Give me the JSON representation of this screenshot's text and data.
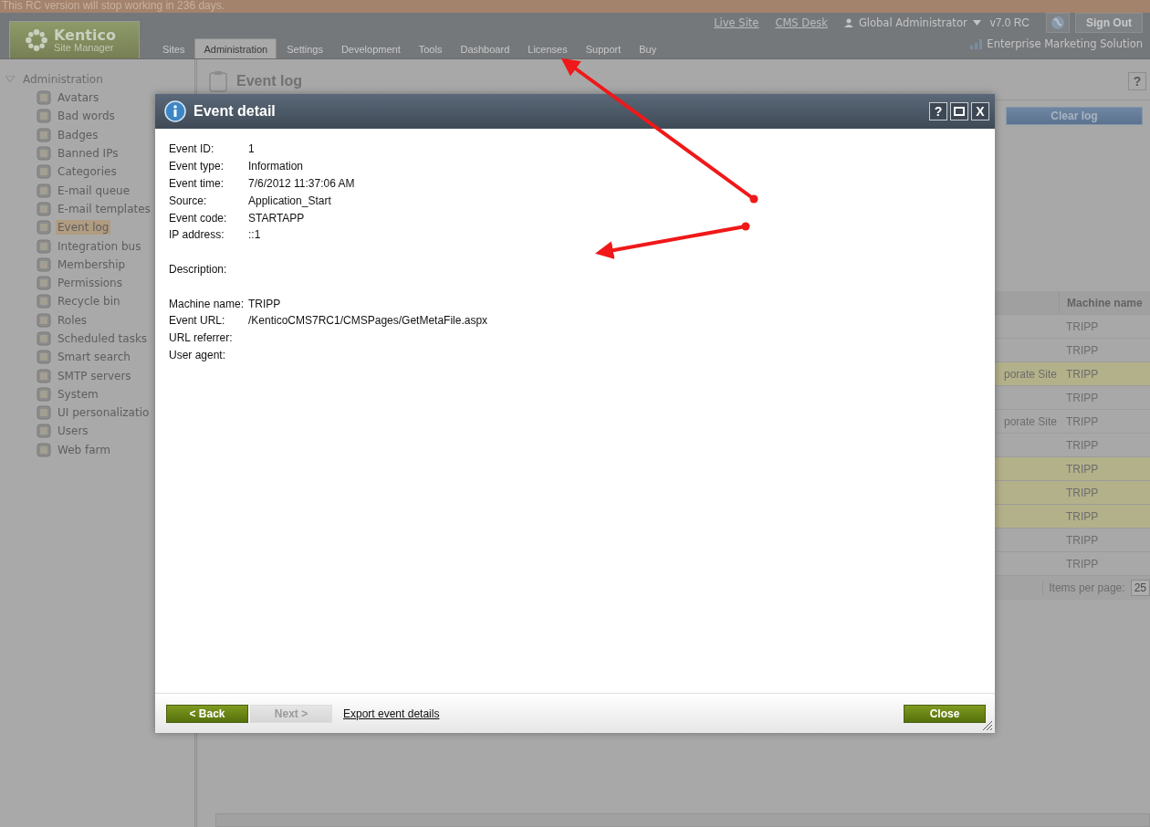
{
  "banner": "This RC version will stop working in 236 days.",
  "header": {
    "logo_title": "Kentico",
    "logo_subtitle": "Site Manager",
    "tabs": [
      {
        "label": "Sites",
        "selected": false
      },
      {
        "label": "Administration",
        "selected": true
      },
      {
        "label": "Settings",
        "selected": false
      },
      {
        "label": "Development",
        "selected": false
      },
      {
        "label": "Tools",
        "selected": false
      },
      {
        "label": "Dashboard",
        "selected": false
      },
      {
        "label": "Licenses",
        "selected": false
      },
      {
        "label": "Support",
        "selected": false
      },
      {
        "label": "Buy",
        "selected": false
      }
    ],
    "links": [
      "Live Site",
      "CMS Desk"
    ],
    "user": "Global Administrator",
    "version": "v7.0 RC",
    "sign_out": "Sign Out",
    "edition": "Enterprise Marketing Solution"
  },
  "sidebar": {
    "root": {
      "label": "Administration",
      "expanded": true,
      "children": [
        {
          "label": "Avatars",
          "selected": false
        },
        {
          "label": "Bad words",
          "selected": false
        },
        {
          "label": "Badges",
          "selected": false
        },
        {
          "label": "Banned IPs",
          "selected": false
        },
        {
          "label": "Categories",
          "selected": false
        },
        {
          "label": "E-mail queue",
          "selected": false
        },
        {
          "label": "E-mail templates",
          "selected": false
        },
        {
          "label": "Event log",
          "selected": true
        },
        {
          "label": "Integration bus",
          "selected": false
        },
        {
          "label": "Membership",
          "selected": false
        },
        {
          "label": "Permissions",
          "selected": false
        },
        {
          "label": "Recycle bin",
          "selected": false
        },
        {
          "label": "Roles",
          "selected": false
        },
        {
          "label": "Scheduled tasks",
          "selected": false
        },
        {
          "label": "Smart search",
          "selected": false
        },
        {
          "label": "SMTP servers",
          "selected": false
        },
        {
          "label": "System",
          "selected": false
        },
        {
          "label": "UI personalizatio",
          "selected": false
        },
        {
          "label": "Users",
          "selected": false
        },
        {
          "label": "Web farm",
          "selected": false
        }
      ]
    }
  },
  "page": {
    "title": "Event log",
    "help": "?",
    "clear_button": "Clear log",
    "table": {
      "columns": [
        "Machine name"
      ],
      "rows": [
        {
          "machine": "TRIPP",
          "highlighted": false
        },
        {
          "machine": "TRIPP",
          "highlighted": false
        },
        {
          "site": "porate Site",
          "machine": "TRIPP",
          "highlighted": true
        },
        {
          "machine": "TRIPP",
          "highlighted": false
        },
        {
          "site": "porate Site",
          "machine": "TRIPP",
          "highlighted": false
        },
        {
          "machine": "TRIPP",
          "highlighted": false
        },
        {
          "machine": "TRIPP",
          "highlighted": true
        },
        {
          "machine": "TRIPP",
          "highlighted": true
        },
        {
          "machine": "TRIPP",
          "highlighted": true
        },
        {
          "machine": "TRIPP",
          "highlighted": false
        },
        {
          "machine": "TRIPP",
          "highlighted": false
        }
      ]
    },
    "pager": {
      "label": "Items per page:",
      "value": "25"
    }
  },
  "dialog": {
    "title": "Event detail",
    "controls": [
      "?",
      "X"
    ],
    "sections": [
      [
        {
          "label": "Event ID:",
          "value": "1"
        },
        {
          "label": "Event type:",
          "value": "Information"
        },
        {
          "label": "Event time:",
          "value": "7/6/2012 11:37:06 AM"
        },
        {
          "label": "Source:",
          "value": "Application_Start"
        },
        {
          "label": "Event code:",
          "value": "STARTAPP"
        },
        {
          "label": "IP address:",
          "value": "::1"
        }
      ],
      [
        {
          "label": "Description:"
        }
      ],
      [
        {
          "label": "Machine name:",
          "value": "TRIPP"
        },
        {
          "label": "Event URL:",
          "value": "/KenticoCMS7RC1/CMSPages/GetMetaFile.aspx"
        },
        {
          "label": "URL referrer:"
        },
        {
          "label": "User agent:"
        }
      ]
    ],
    "back": {
      "label": "< Back",
      "disabled": false
    },
    "next": {
      "label": "Next >",
      "disabled": true
    },
    "export": "Export event details",
    "close": "Close"
  }
}
